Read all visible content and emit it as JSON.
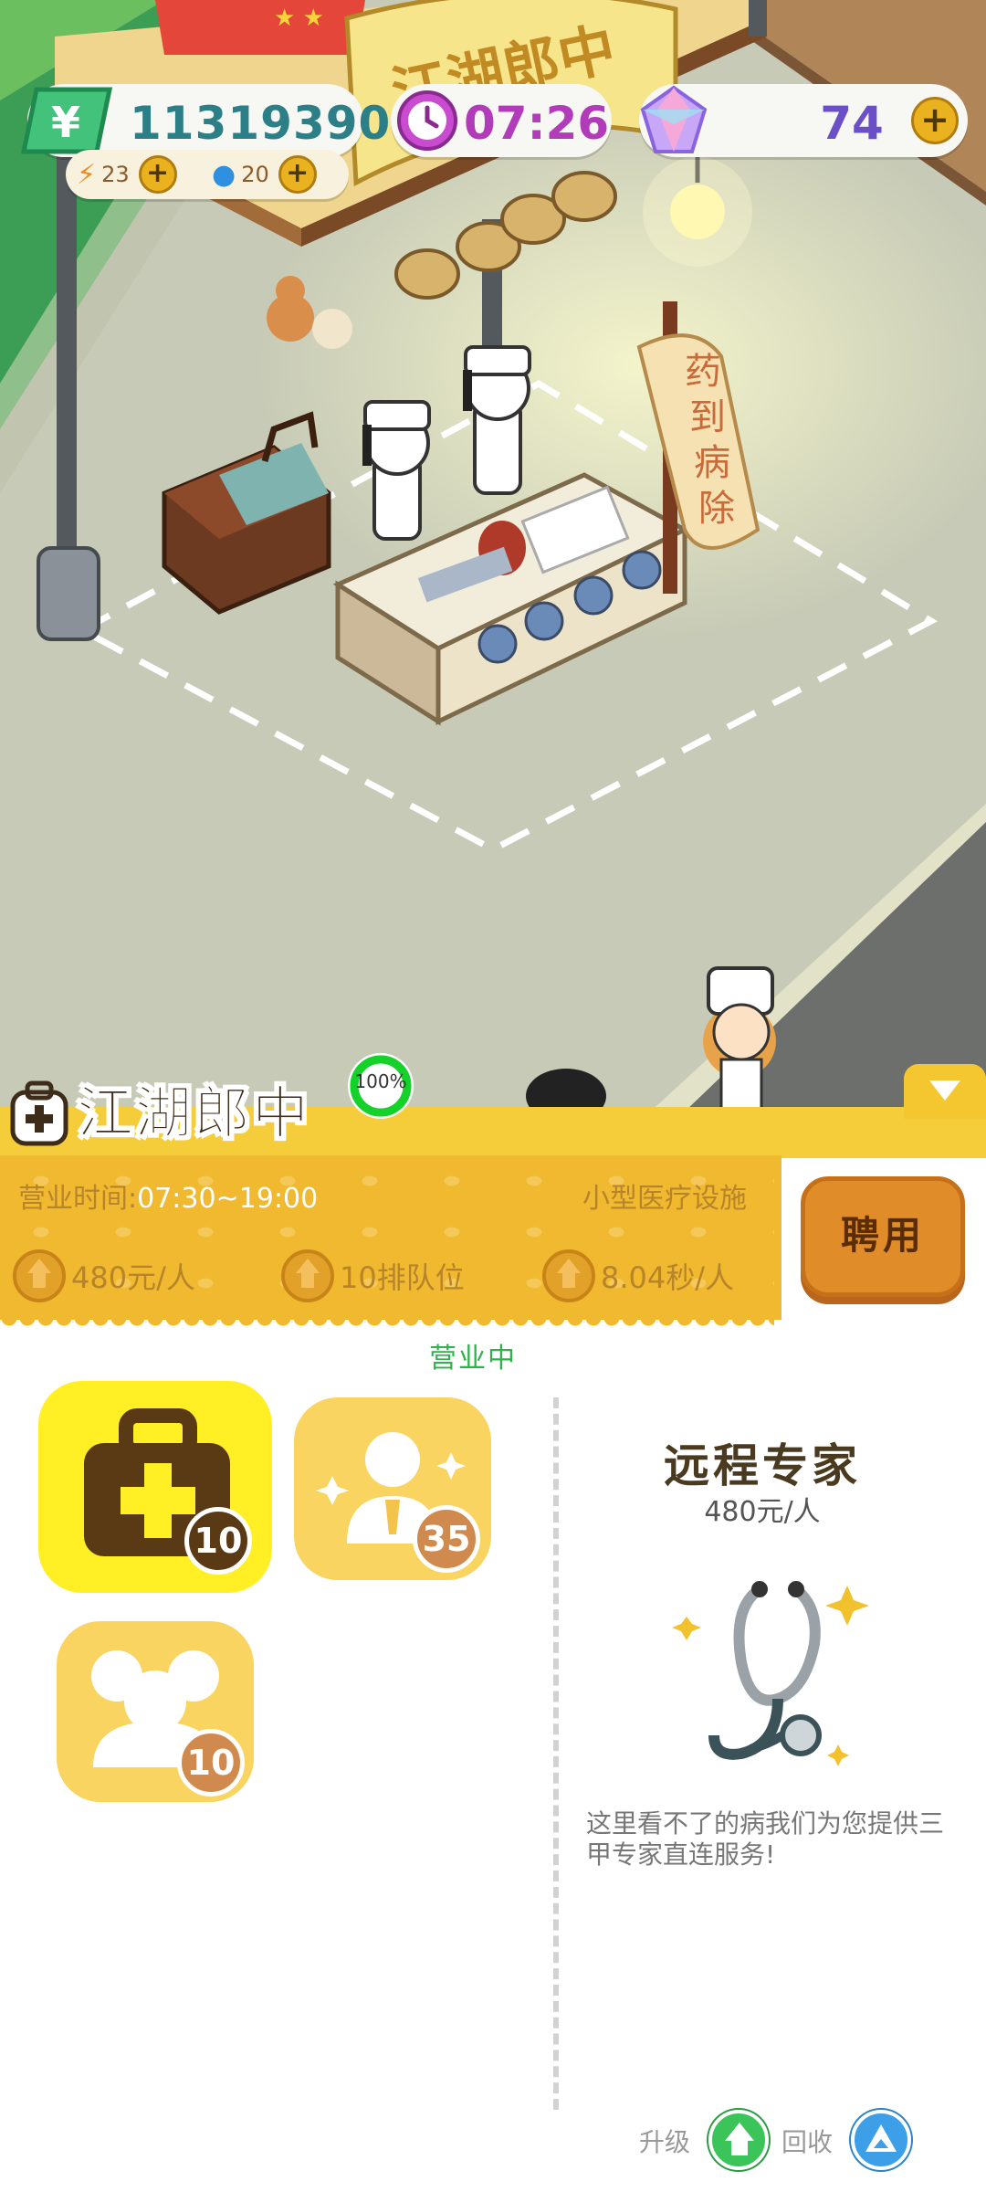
{
  "hud": {
    "money": "11319390",
    "energy": "23",
    "water": "20",
    "clock": "07:26",
    "gems": "74",
    "plus": "+"
  },
  "scene": {
    "sign_text": "江湖郎中",
    "banner_text": "药到病除"
  },
  "stall": {
    "name": "江湖郎中",
    "progress": "100%",
    "progress_value": 1.0,
    "hours_label": "营业时间:",
    "hours_value": "07:30~19:00",
    "facility": "小型医疗设施",
    "stats": [
      {
        "text": "480元/人"
      },
      {
        "text": "10排队位"
      },
      {
        "text": "8.04秒/人"
      }
    ],
    "hire_label": "聘用",
    "status": "营业中"
  },
  "tiles": [
    {
      "name": "medical-kit",
      "badge": "10"
    },
    {
      "name": "expert",
      "badge": "35"
    },
    {
      "name": "group",
      "badge": "10"
    }
  ],
  "detail": {
    "title": "远程专家",
    "price": "480元/人",
    "description": "这里看不了的病我们为您提供三甲专家直连服务!"
  },
  "actions": {
    "upgrade_label": "升级",
    "recycle_label": "回收"
  },
  "colors": {
    "money": "#2c7f87",
    "clock": "#b13bb8",
    "gem": "#6a4fc7",
    "panel": "#f0b930",
    "hire": "#e08c29",
    "status": "#2fb24b"
  },
  "icons": [
    "money-icon",
    "energy-icon",
    "water-icon",
    "clock-icon",
    "gem-icon",
    "plus-icon",
    "medical-kit-icon",
    "expert-icon",
    "group-icon",
    "stethoscope-icon",
    "upgrade-icon",
    "recycle-icon",
    "stall-icon"
  ]
}
